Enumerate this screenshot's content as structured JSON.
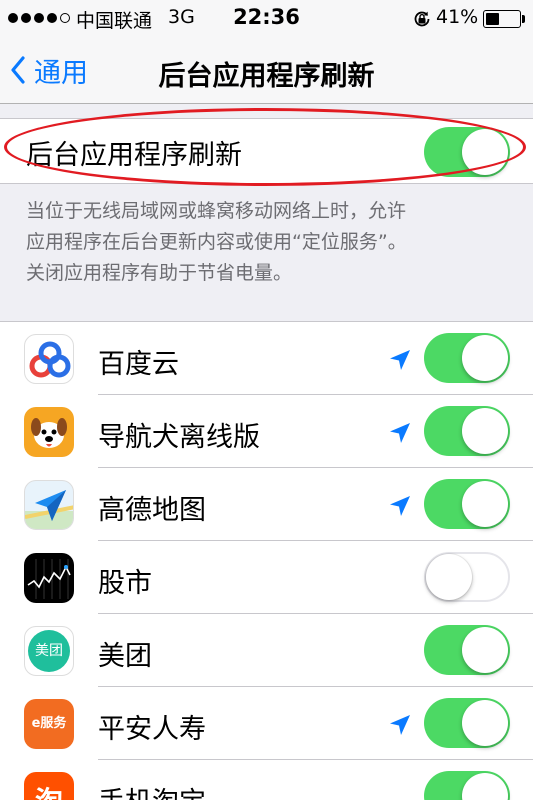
{
  "status_bar": {
    "carrier": "中国联通",
    "network": "3G",
    "time": "22:36",
    "battery": "41%",
    "battery_level": 0.41,
    "signal_bars_filled": 4,
    "signal_bars_total": 5
  },
  "nav": {
    "back_label": "通用",
    "title": "后台应用程序刷新"
  },
  "master": {
    "label": "后台应用程序刷新",
    "enabled": true
  },
  "footnote": {
    "line1": "当位于无线局域网或蜂窝移动网络上时，允许",
    "line2": "应用程序在后台更新内容或使用“定位服务”。",
    "line3": "关闭应用程序有助于节省电量。"
  },
  "apps": [
    {
      "name": "百度云",
      "enabled": true,
      "uses_location": true,
      "icon": "baidu-cloud-icon"
    },
    {
      "name": "导航犬离线版",
      "enabled": true,
      "uses_location": true,
      "icon": "navigation-dog-icon"
    },
    {
      "name": "高德地图",
      "enabled": true,
      "uses_location": true,
      "icon": "amap-icon"
    },
    {
      "name": "股市",
      "enabled": false,
      "uses_location": false,
      "icon": "stocks-icon"
    },
    {
      "name": "美团",
      "enabled": true,
      "uses_location": false,
      "icon": "meituan-icon",
      "icon_text": "美团"
    },
    {
      "name": "平安人寿",
      "enabled": true,
      "uses_location": true,
      "icon": "pingan-icon",
      "icon_text": "e服务"
    },
    {
      "name": "手机淘宝",
      "enabled": true,
      "uses_location": false,
      "icon": "taobao-icon",
      "icon_text": "淘"
    }
  ],
  "colors": {
    "accent": "#0a7aff",
    "toggle_on": "#4cd964",
    "annotation": "#e11b22"
  }
}
